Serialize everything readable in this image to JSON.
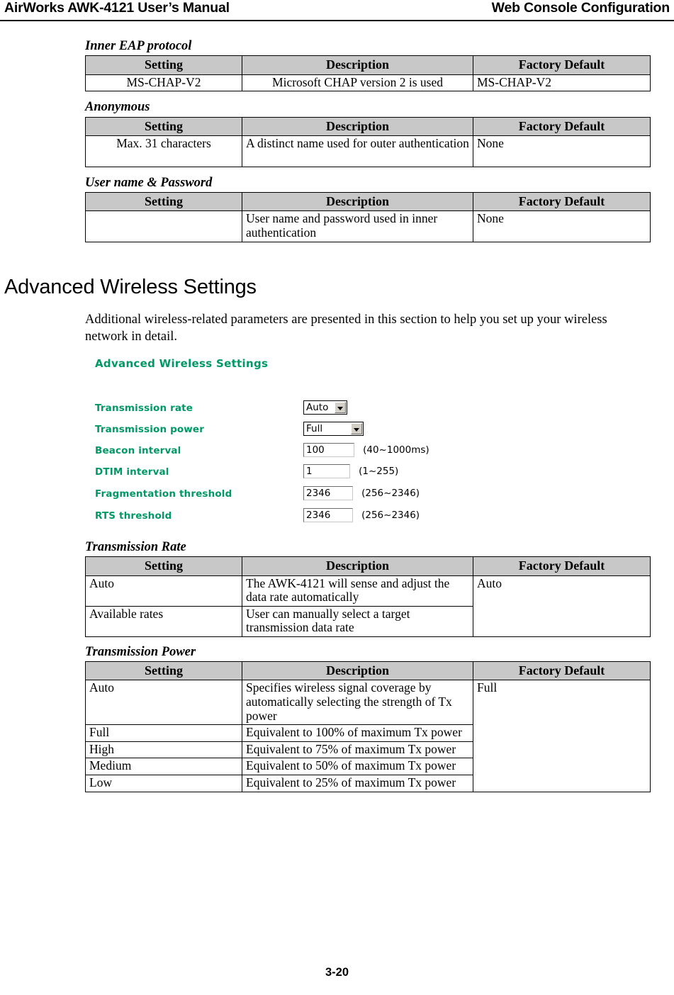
{
  "header": {
    "left_title": "AirWorks AWK-4121 User’s Manual",
    "right_title": "Web Console Configuration"
  },
  "footer": {
    "page_number": "3-20"
  },
  "table_headers": {
    "setting": "Setting",
    "description": "Description",
    "factory_default": "Factory Default"
  },
  "sections": {
    "inner_eap": {
      "caption": "Inner EAP protocol",
      "rows": [
        {
          "setting": "MS-CHAP-V2",
          "description": "Microsoft CHAP version 2 is used",
          "default": "MS-CHAP-V2"
        }
      ]
    },
    "anonymous": {
      "caption": "Anonymous",
      "rows": [
        {
          "setting": "Max. 31 characters",
          "description": "A distinct name used for outer authentication",
          "default": "None"
        }
      ]
    },
    "user_name_password": {
      "caption": "User name & Password",
      "rows": [
        {
          "setting": "",
          "description": "User name and password used in inner authentication",
          "default": "None"
        }
      ]
    },
    "advanced_wireless": {
      "heading": "Advanced Wireless Settings",
      "intro": "Additional wireless-related parameters are presented in this section to help you set up your wireless network in detail."
    },
    "transmission_rate": {
      "caption": "Transmission Rate",
      "default": "Auto",
      "rows": [
        {
          "setting": "Auto",
          "description": "The AWK-4121 will sense and adjust the data rate automatically"
        },
        {
          "setting": "Available rates",
          "description": "User can manually select a target transmission data rate"
        }
      ]
    },
    "transmission_power": {
      "caption": "Transmission Power",
      "default": "Full",
      "rows": [
        {
          "setting": "Auto",
          "description": "Specifies wireless signal coverage by automatically selecting the strength of Tx power"
        },
        {
          "setting": "Full",
          "description": "Equivalent to 100% of maximum Tx power"
        },
        {
          "setting": "High",
          "description": "Equivalent to 75% of maximum Tx power"
        },
        {
          "setting": "Medium",
          "description": "Equivalent to 50% of maximum Tx power"
        },
        {
          "setting": "Low",
          "description": "Equivalent to 25% of maximum Tx power"
        }
      ]
    }
  },
  "web_console": {
    "title": "Advanced Wireless Settings",
    "label_color": "#009966",
    "fields": [
      {
        "label": "Transmission rate",
        "type": "select",
        "value": "Auto",
        "hint": ""
      },
      {
        "label": "Transmission power",
        "type": "select",
        "value": "Full",
        "hint": ""
      },
      {
        "label": "Beacon interval",
        "type": "input",
        "value": "100",
        "hint": "(40~1000ms)"
      },
      {
        "label": "DTIM interval",
        "type": "input",
        "value": "1",
        "hint": "(1~255)"
      },
      {
        "label": "Fragmentation threshold",
        "type": "input",
        "value": "2346",
        "hint": "(256~2346)"
      },
      {
        "label": "RTS threshold",
        "type": "input",
        "value": "2346",
        "hint": "(256~2346)"
      }
    ]
  }
}
